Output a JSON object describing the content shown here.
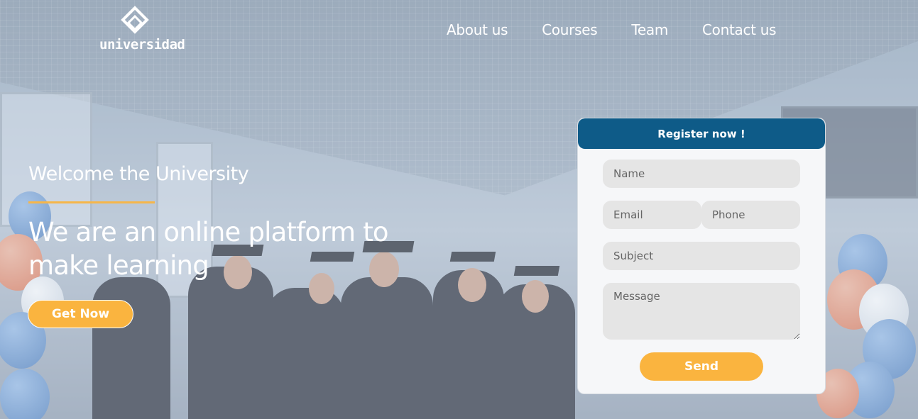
{
  "logo": {
    "text": "universidad",
    "icon": "diamond-logo-icon"
  },
  "nav": {
    "items": [
      {
        "label": "About us"
      },
      {
        "label": "Courses"
      },
      {
        "label": "Team"
      },
      {
        "label": "Contact us"
      }
    ]
  },
  "hero": {
    "welcome": "Welcome the University",
    "headline": "We are an online platform to make learning",
    "cta_label": "Get Now"
  },
  "form": {
    "title": "Register now !",
    "name_placeholder": "Name",
    "email_placeholder": "Email",
    "phone_placeholder": "Phone",
    "subject_placeholder": "Subject",
    "message_placeholder": "Message",
    "send_label": "Send"
  },
  "colors": {
    "accent": "#fab43f",
    "header_blue": "#0e5b88",
    "field_bg": "#e5e5e5"
  }
}
